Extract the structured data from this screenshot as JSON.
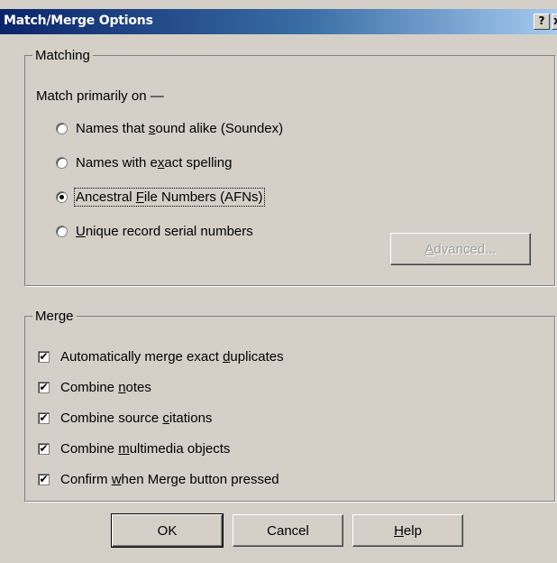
{
  "window": {
    "title": "Match/Merge Options",
    "help_glyph": "?",
    "close_glyph": "x"
  },
  "matching": {
    "legend": "Matching",
    "subtitle": "Match primarily on —",
    "options": [
      {
        "pre": "Names that ",
        "mnemonic": "s",
        "post": "ound alike (Soundex)",
        "selected": false
      },
      {
        "pre": "Names with e",
        "mnemonic": "x",
        "post": "act spelling",
        "selected": false
      },
      {
        "pre": "Ancestral ",
        "mnemonic": "F",
        "post": "ile Numbers (AFNs)",
        "selected": true
      },
      {
        "pre": "",
        "mnemonic": "U",
        "post": "nique record serial numbers",
        "selected": false
      }
    ],
    "advanced": {
      "pre": "",
      "mnemonic": "A",
      "post": "dvanced...",
      "enabled": false
    }
  },
  "merge": {
    "legend": "Merge",
    "options": [
      {
        "pre": "Automatically merge exact ",
        "mnemonic": "d",
        "post": "uplicates",
        "checked": true
      },
      {
        "pre": "Combine ",
        "mnemonic": "n",
        "post": "otes",
        "checked": true
      },
      {
        "pre": "Combine source ",
        "mnemonic": "c",
        "post": "itations",
        "checked": true
      },
      {
        "pre": "Combine ",
        "mnemonic": "m",
        "post": "ultimedia objects",
        "checked": true
      },
      {
        "pre": "Confirm ",
        "mnemonic": "w",
        "post": "hen Merge button pressed",
        "checked": true
      }
    ]
  },
  "buttons": {
    "ok": "OK",
    "cancel": "Cancel",
    "help": {
      "pre": "",
      "mnemonic": "H",
      "post": "elp"
    }
  },
  "checkmark_glyph": "✔"
}
